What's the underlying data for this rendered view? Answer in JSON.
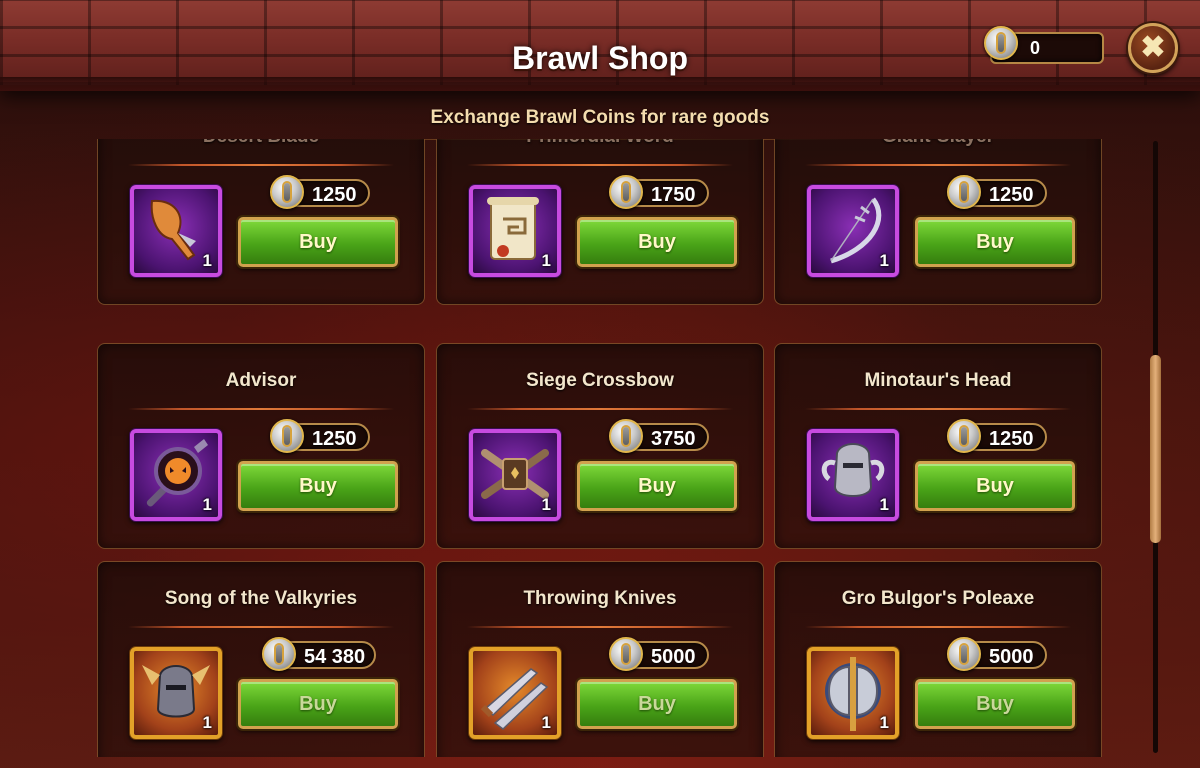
{
  "window": {
    "title": "Brawl Shop",
    "subtitle": "Exchange Brawl Coins for rare goods",
    "close_icon": "close-x-icon"
  },
  "currency": {
    "icon": "brawl-coin-icon",
    "value": "0"
  },
  "colors": {
    "buy_button": "#4aa418",
    "rare_frame": "#c74be0",
    "legendary_frame": "#e3a128",
    "frame_gold": "#d1a24e"
  },
  "items": [
    {
      "name": "Desert Blade",
      "icon": "curved-dagger-icon",
      "quantity": "1",
      "price": "1250",
      "buy_label": "Buy",
      "rarity": "purple"
    },
    {
      "name": "Primordial Word",
      "icon": "scroll-icon",
      "quantity": "1",
      "price": "1750",
      "buy_label": "Buy",
      "rarity": "purple"
    },
    {
      "name": "Giant-Slayer",
      "icon": "bow-icon",
      "quantity": "1",
      "price": "1250",
      "buy_label": "Buy",
      "rarity": "purple"
    },
    {
      "name": "Advisor",
      "icon": "staff-orb-icon",
      "quantity": "1",
      "price": "1250",
      "buy_label": "Buy",
      "rarity": "purple"
    },
    {
      "name": "Siege Crossbow",
      "icon": "crossbow-icon",
      "quantity": "1",
      "price": "3750",
      "buy_label": "Buy",
      "rarity": "purple"
    },
    {
      "name": "Minotaur's Head",
      "icon": "horned-helmet-icon",
      "quantity": "1",
      "price": "1250",
      "buy_label": "Buy",
      "rarity": "purple"
    },
    {
      "name": "Song of the Valkyries",
      "icon": "winged-helmet-icon",
      "quantity": "1",
      "price": "54 380",
      "buy_label": "Buy",
      "rarity": "gold"
    },
    {
      "name": "Throwing Knives",
      "icon": "knives-icon",
      "quantity": "1",
      "price": "5000",
      "buy_label": "Buy",
      "rarity": "gold"
    },
    {
      "name": "Gro Bulgor's Poleaxe",
      "icon": "poleaxe-icon",
      "quantity": "1",
      "price": "5000",
      "buy_label": "Buy",
      "rarity": "gold"
    }
  ]
}
